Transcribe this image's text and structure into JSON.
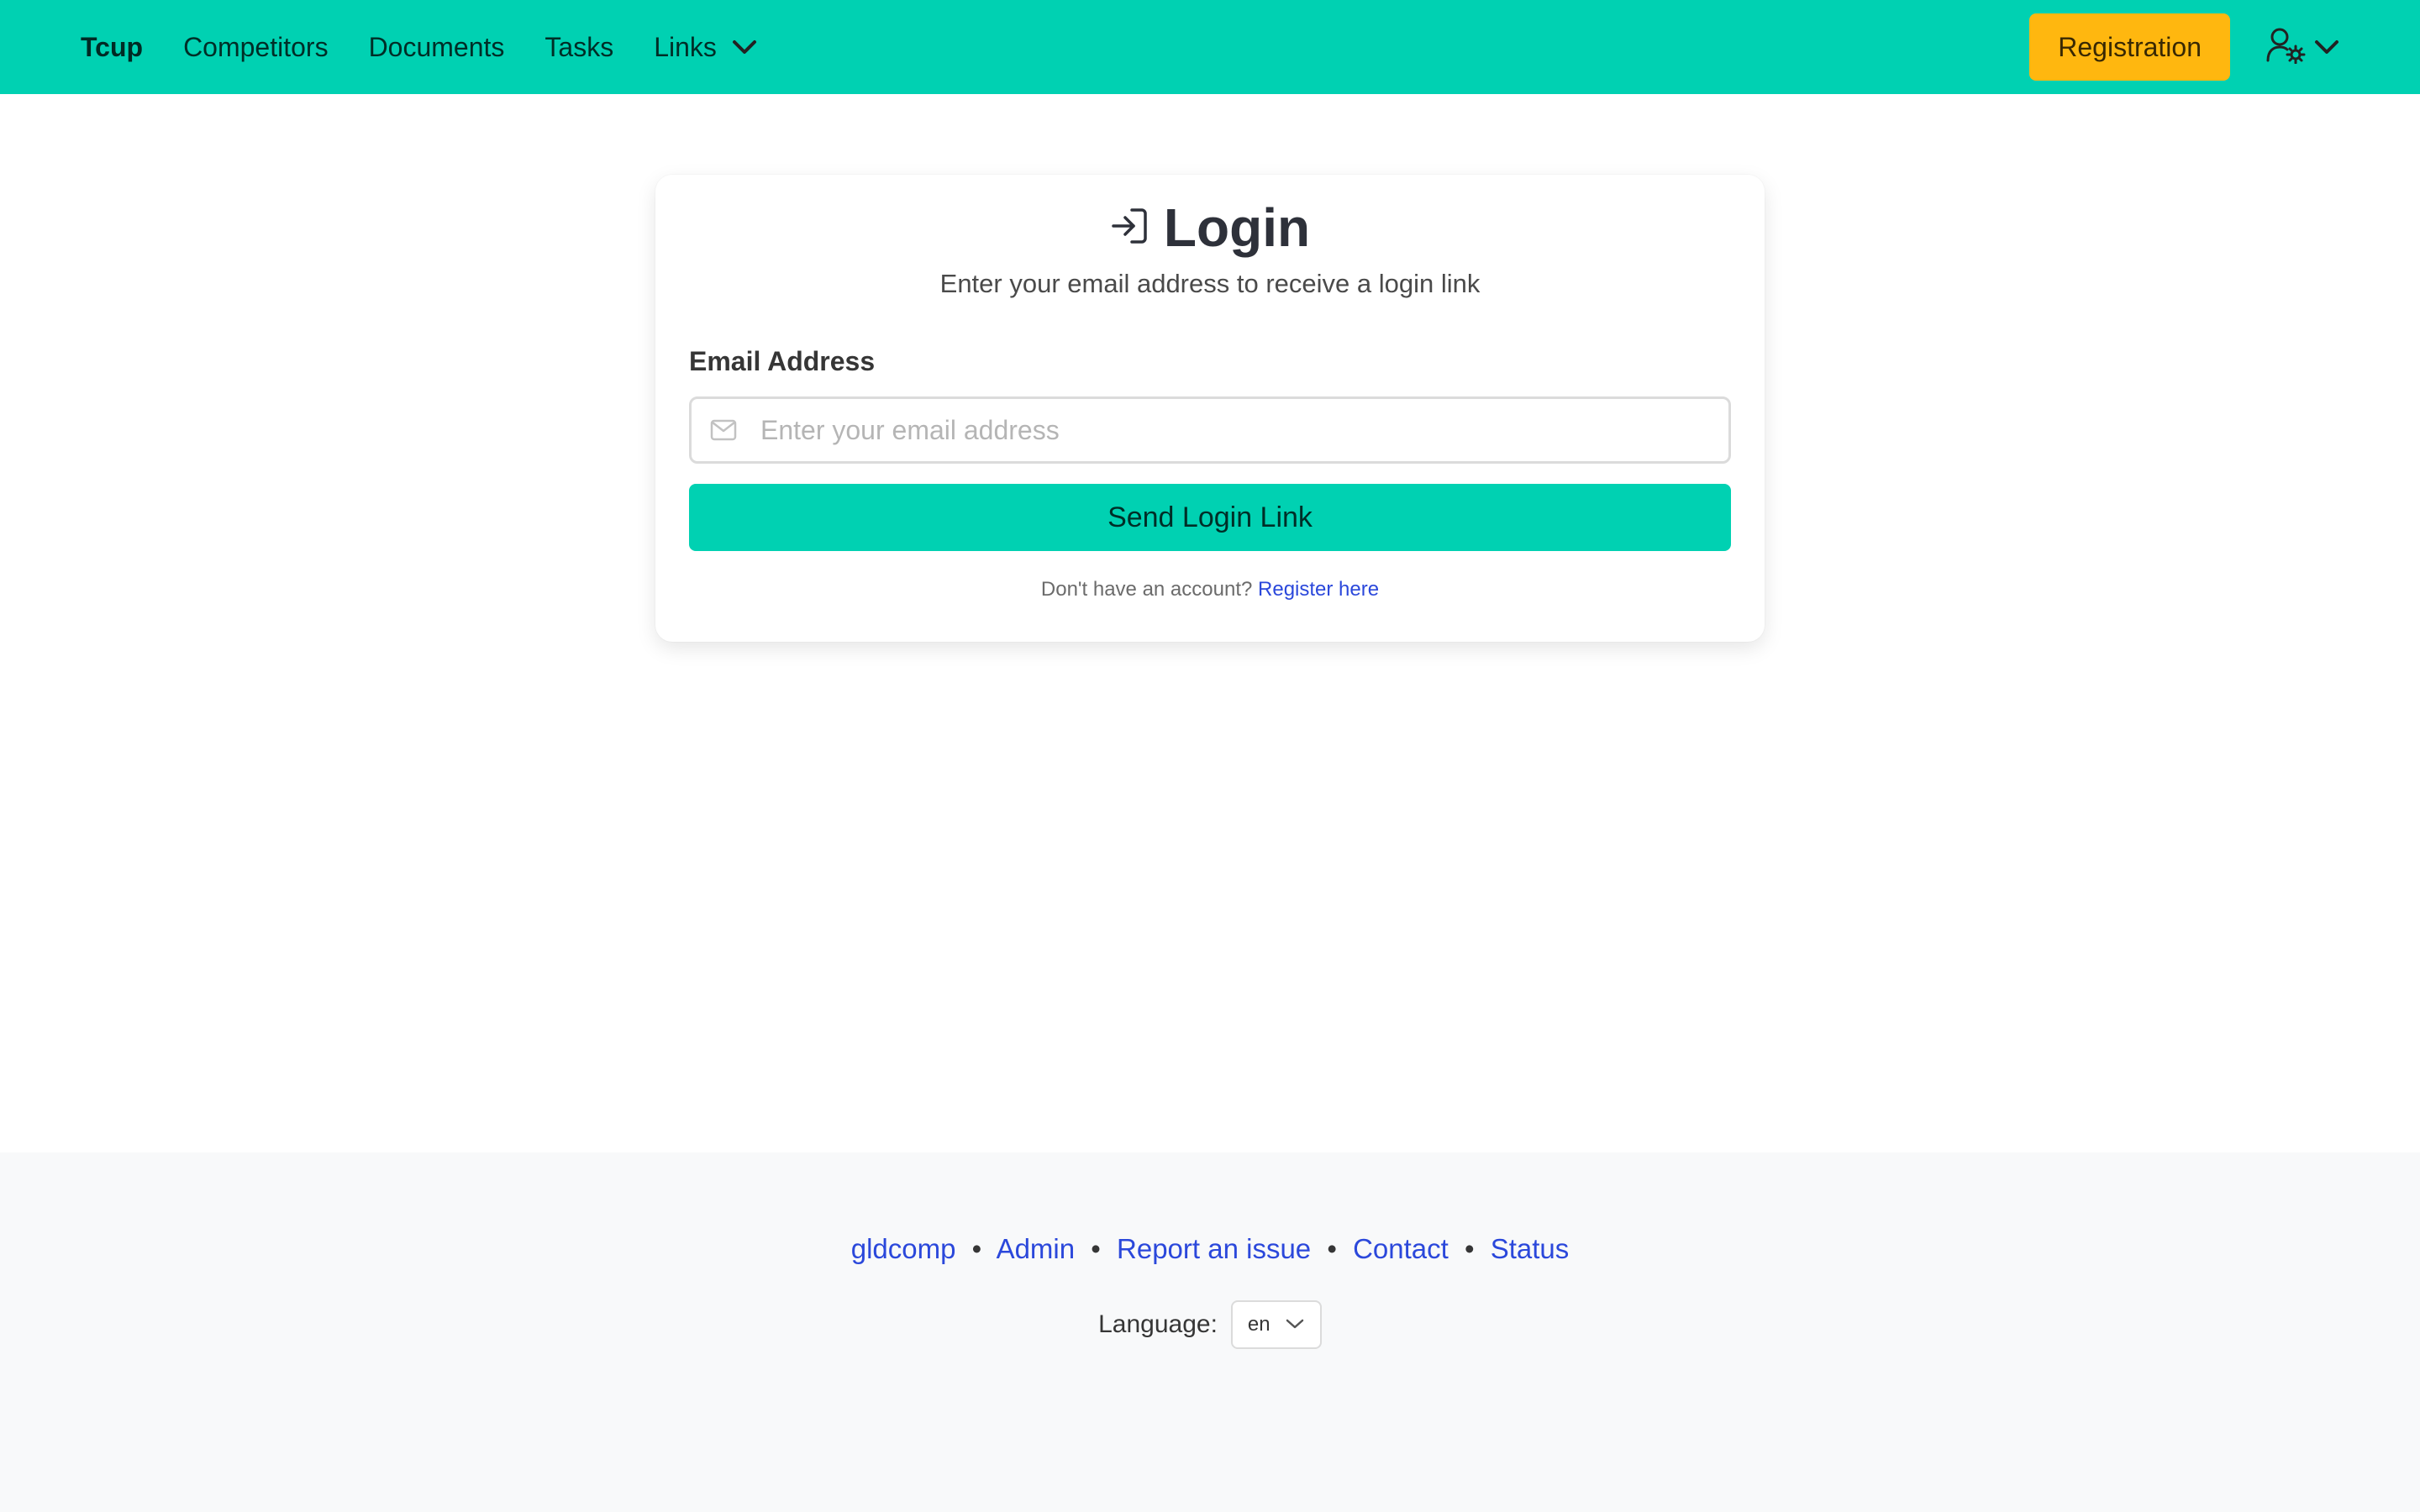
{
  "navbar": {
    "brand": "Tcup",
    "items": [
      {
        "label": "Competitors"
      },
      {
        "label": "Documents"
      },
      {
        "label": "Tasks"
      },
      {
        "label": "Links"
      }
    ],
    "registration_label": "Registration",
    "user_menu_icon": "user-gear-icon"
  },
  "login": {
    "title": "Login",
    "title_icon": "sign-in-icon",
    "subtitle": "Enter your email address to receive a login link",
    "email_label": "Email Address",
    "email_placeholder": "Enter your email address",
    "email_value": "",
    "email_icon": "envelope-icon",
    "send_label": "Send Login Link",
    "no_account_text": "Don't have an account?",
    "register_link": "Register here"
  },
  "footer": {
    "links": [
      "gldcomp",
      "Admin",
      "Report an issue",
      "Contact",
      "Status"
    ],
    "separator": "•",
    "language_label": "Language:",
    "language_value": "en"
  },
  "colors": {
    "primary": "#00d1b2",
    "warning": "#ffb70f",
    "link": "#2b48db",
    "footer_bg": "#f8f9fa"
  }
}
